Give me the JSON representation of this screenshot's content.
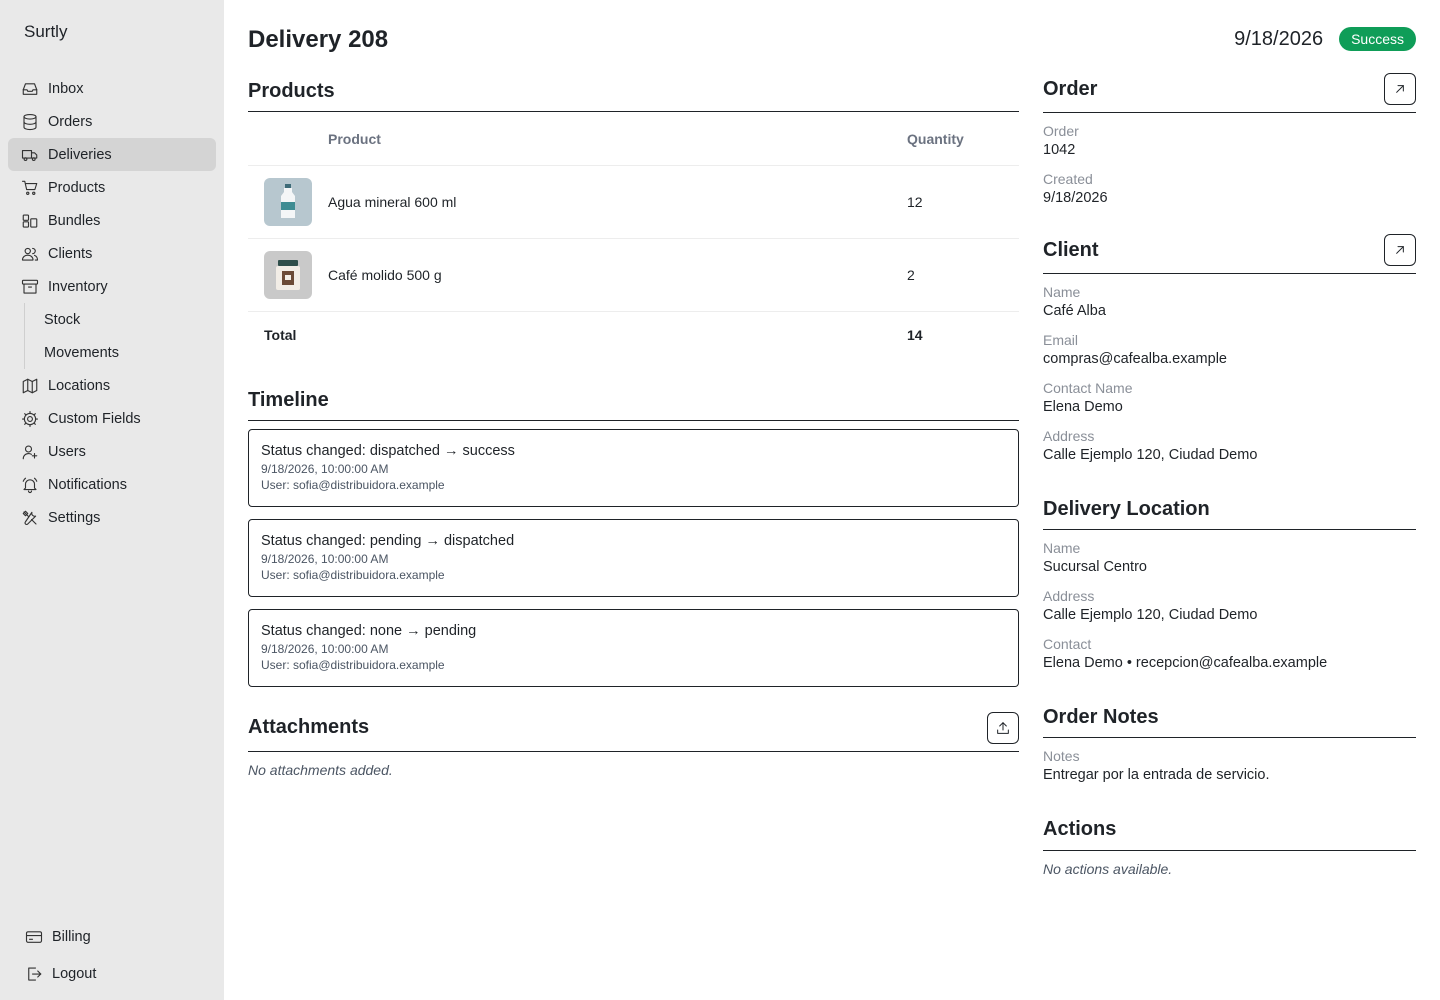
{
  "app": {
    "name": "Surtly"
  },
  "sidebar": {
    "items": [
      {
        "label": "Inbox",
        "icon": "inbox-icon"
      },
      {
        "label": "Orders",
        "icon": "database-icon"
      },
      {
        "label": "Deliveries",
        "icon": "truck-icon",
        "active": true
      },
      {
        "label": "Products",
        "icon": "cart-icon"
      },
      {
        "label": "Bundles",
        "icon": "bundles-icon"
      },
      {
        "label": "Clients",
        "icon": "users-icon"
      },
      {
        "label": "Inventory",
        "icon": "archive-icon"
      }
    ],
    "subitems": [
      {
        "label": "Stock"
      },
      {
        "label": "Movements"
      }
    ],
    "items2": [
      {
        "label": "Locations",
        "icon": "map-icon"
      },
      {
        "label": "Custom Fields",
        "icon": "cog-icon"
      },
      {
        "label": "Users",
        "icon": "user-plus-icon"
      },
      {
        "label": "Notifications",
        "icon": "bell-icon"
      },
      {
        "label": "Settings",
        "icon": "tools-icon"
      }
    ],
    "bottom": [
      {
        "label": "Billing",
        "icon": "credit-card-icon"
      },
      {
        "label": "Logout",
        "icon": "logout-icon"
      }
    ]
  },
  "header": {
    "title": "Delivery 208",
    "date": "9/18/2026",
    "status": "Success",
    "status_color": "#0f9d58"
  },
  "products": {
    "title": "Products",
    "columns": {
      "product": "Product",
      "quantity": "Quantity"
    },
    "rows": [
      {
        "name": "Agua mineral 600 ml",
        "quantity": "12",
        "icon": "water-bottle-icon"
      },
      {
        "name": "Café molido 500 g",
        "quantity": "2",
        "icon": "coffee-jar-icon"
      }
    ],
    "total_label": "Total",
    "total_value": "14"
  },
  "timeline": {
    "title": "Timeline",
    "events": [
      {
        "title": "Status changed: dispatched → success",
        "time": "9/18/2026, 10:00:00 AM",
        "user": "User: sofia@distribuidora.example"
      },
      {
        "title": "Status changed: pending → dispatched",
        "time": "9/18/2026, 10:00:00 AM",
        "user": "User: sofia@distribuidora.example"
      },
      {
        "title": "Status changed: none → pending",
        "time": "9/18/2026, 10:00:00 AM",
        "user": "User: sofia@distribuidora.example"
      }
    ]
  },
  "attachments": {
    "title": "Attachments",
    "empty": "No attachments added."
  },
  "order": {
    "title": "Order",
    "fields": [
      {
        "label": "Order",
        "value": "1042"
      },
      {
        "label": "Created",
        "value": "9/18/2026"
      }
    ]
  },
  "client": {
    "title": "Client",
    "fields": [
      {
        "label": "Name",
        "value": "Café Alba"
      },
      {
        "label": "Email",
        "value": "compras@cafealba.example"
      },
      {
        "label": "Contact Name",
        "value": "Elena Demo"
      },
      {
        "label": "Address",
        "value": "Calle Ejemplo 120, Ciudad Demo"
      }
    ]
  },
  "delivery_location": {
    "title": "Delivery Location",
    "fields": [
      {
        "label": "Name",
        "value": "Sucursal Centro"
      },
      {
        "label": "Address",
        "value": "Calle Ejemplo 120, Ciudad Demo"
      },
      {
        "label": "Contact",
        "value": "Elena Demo • recepcion@cafealba.example"
      }
    ]
  },
  "order_notes": {
    "title": "Order Notes",
    "fields": [
      {
        "label": "Notes",
        "value": "Entregar por la entrada de servicio."
      }
    ]
  },
  "actions": {
    "title": "Actions",
    "empty": "No actions available."
  }
}
